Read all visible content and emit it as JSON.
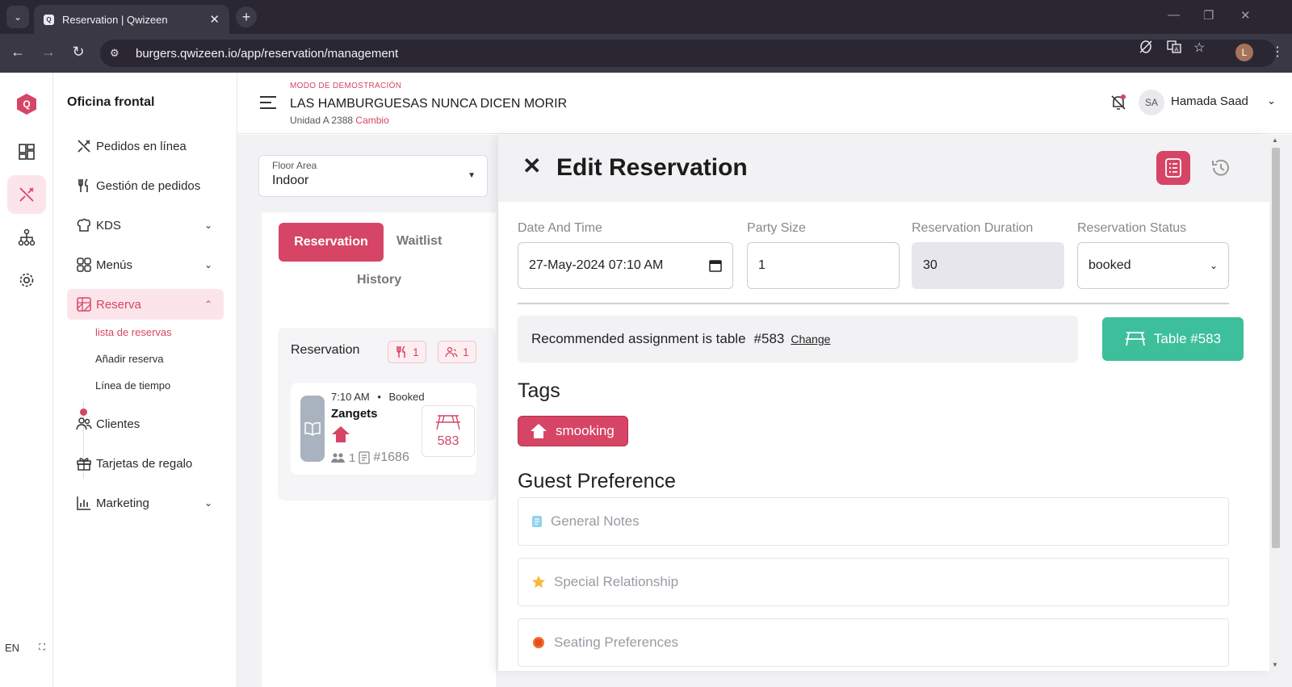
{
  "browser": {
    "tab_title": "Reservation | Qwizeen",
    "url": "burgers.qwizeen.io/app/reservation/management",
    "profile_initial": "L"
  },
  "sidebar": {
    "title": "Oficina frontal",
    "items": [
      {
        "label": "Pedidos en línea",
        "icon": "fork-knife-icon"
      },
      {
        "label": "Gestión de pedidos",
        "icon": "utensils-icon"
      },
      {
        "label": "KDS",
        "icon": "chef-hat-icon"
      },
      {
        "label": "Menús",
        "icon": "grid-icon"
      },
      {
        "label": "Reserva",
        "icon": "calendar-grid-icon"
      },
      {
        "label": "Clientes",
        "icon": "users-icon"
      },
      {
        "label": "Tarjetas de regalo",
        "icon": "gift-icon"
      },
      {
        "label": "Marketing",
        "icon": "bar-chart-icon"
      }
    ],
    "sub_items": [
      "lista de reservas",
      "Añadir reserva",
      "Línea de tiempo"
    ],
    "language": "EN"
  },
  "header": {
    "demo_mode": "MODO DE DEMOSTRACIÓN",
    "restaurant": "LAS HAMBURGUESAS NUNCA DICEN MORIR",
    "unit": "Unidad A 2388",
    "change": "Cambio",
    "user_initials": "SA",
    "user_name": "Hamada Saad"
  },
  "floor": {
    "label": "Floor Area",
    "value": "Indoor"
  },
  "list": {
    "tab_reservation": "Reservation",
    "tab_waitlist": "Waitlist",
    "tab_history": "History",
    "card_title": "Reservation",
    "count_tables": "1",
    "count_guests": "1",
    "entry": {
      "time": "7:10 AM",
      "status": "Booked",
      "name": "Zangets",
      "party": "1",
      "id": "#1686",
      "table": "583"
    }
  },
  "drawer": {
    "title": "Edit Reservation",
    "date_label": "Date And Time",
    "date_value": "27-May-2024 07:10  AM",
    "party_label": "Party Size",
    "party_value": "1",
    "duration_label": "Reservation Duration",
    "duration_value": "30",
    "status_label": "Reservation Status",
    "status_value": "booked",
    "recommend_text": "Recommended assignment is table",
    "recommend_table": "#583",
    "recommend_change": "Change",
    "table_button": "Table #583",
    "tags_heading": "Tags",
    "tag": "smooking",
    "guest_heading": "Guest Preference",
    "prefs": [
      "General Notes",
      "Special Relationship",
      "Seating Preferences"
    ]
  },
  "colors": {
    "brand": "#d64565",
    "brand_light": "#fbe5ea",
    "table_green": "#3dbf9c",
    "browser_dark": "#2a2733"
  }
}
